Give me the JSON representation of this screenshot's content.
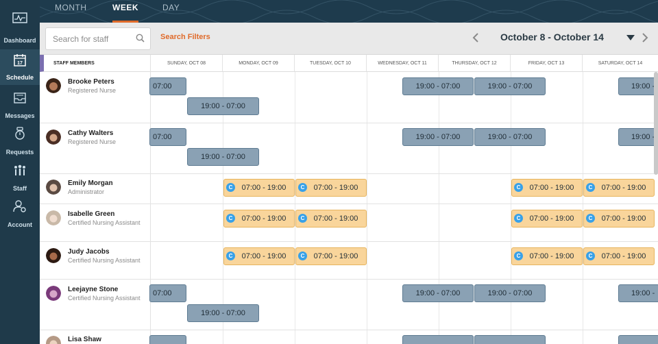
{
  "sidebar": {
    "items": [
      {
        "label": "Dashboard",
        "icon": "dashboard-icon"
      },
      {
        "label": "Schedule",
        "icon": "calendar-icon"
      },
      {
        "label": "Messages",
        "icon": "inbox-icon"
      },
      {
        "label": "Requests",
        "icon": "stopwatch-icon"
      },
      {
        "label": "Staff",
        "icon": "people-icon"
      },
      {
        "label": "Account",
        "icon": "user-gear-icon"
      }
    ]
  },
  "tabs": [
    {
      "label": "MONTH"
    },
    {
      "label": "WEEK"
    },
    {
      "label": "DAY"
    }
  ],
  "toolbar": {
    "search_placeholder": "Search for staff",
    "filters_label": "Search Filters",
    "date_range": "October 8 - October 14"
  },
  "header": {
    "staff_label": "STAFF MEMBERS",
    "days": [
      "SUNDAY, OCT 08",
      "MONDAY, OCT 09",
      "TUESDAY, OCT 10",
      "WEDNESDAY, OCT 11",
      "THURSDAY, OCT 12",
      "FRIDAY, OCT 13",
      "SATURDAY, OCT 14"
    ]
  },
  "staff": [
    {
      "name": "Brooke Peters",
      "role": "Registered Nurse"
    },
    {
      "name": "Cathy Walters",
      "role": "Registered Nurse"
    },
    {
      "name": "Emily Morgan",
      "role": "Administrator"
    },
    {
      "name": "Isabelle Green",
      "role": "Certified Nursing Assistant"
    },
    {
      "name": "Judy Jacobs",
      "role": "Certified Nursing Assistant"
    },
    {
      "name": "Leejayne Stone",
      "role": "Certified Nursing Assistant"
    },
    {
      "name": "Lisa Shaw",
      "role": ""
    }
  ],
  "shifts": {
    "night_full": "19:00 - 07:00",
    "night_end": "07:00",
    "night_start_partial": "19:00 -",
    "day": "07:00 - 19:00",
    "badge": "C"
  },
  "colors": {
    "accent": "#e06a2a",
    "night_shift": "#8aa1b4",
    "day_shift": "#f9d59b",
    "badge": "#38a1e8",
    "sidebar": "#1f3a4a"
  }
}
